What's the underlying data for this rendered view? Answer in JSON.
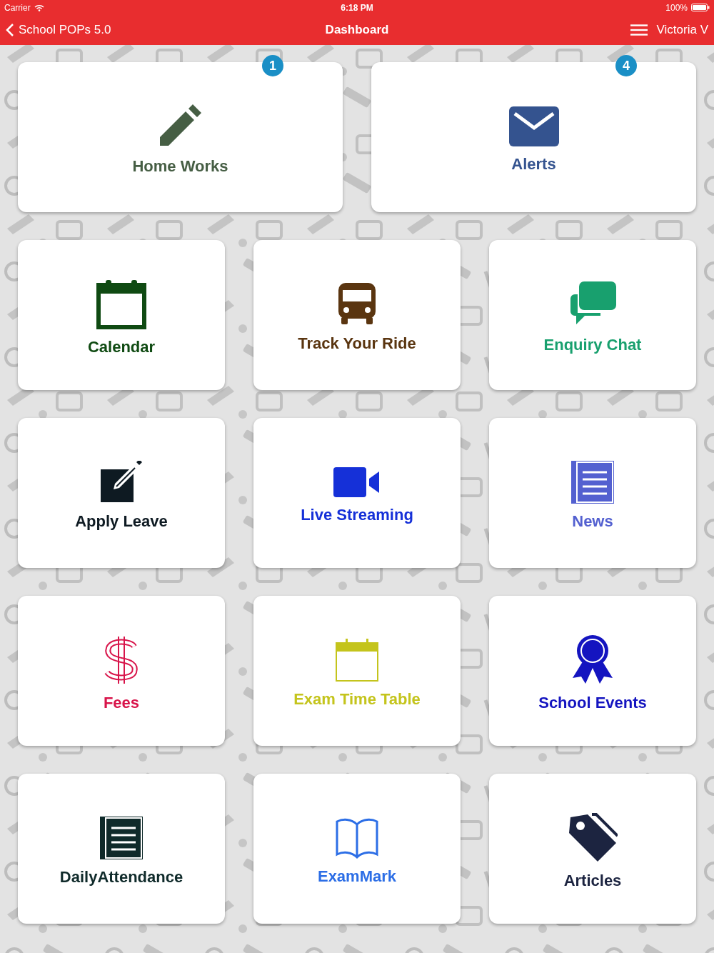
{
  "status_bar": {
    "carrier": "Carrier",
    "time": "6:18 PM",
    "battery": "100%"
  },
  "nav_bar": {
    "back_label": "School POPs 5.0",
    "title": "Dashboard",
    "user": "Victoria V"
  },
  "featured_tiles": [
    {
      "label": "Home Works",
      "kind": "pencil",
      "color": "#465e44",
      "badge": "1"
    },
    {
      "label": "Alerts",
      "kind": "envelope",
      "color": "#34538f",
      "badge": "4"
    }
  ],
  "tiles": [
    {
      "label": "Calendar",
      "kind": "calendar",
      "color": "#0f4a12"
    },
    {
      "label": "Track Your Ride",
      "kind": "bus",
      "color": "#5a3510"
    },
    {
      "label": "Enquiry Chat",
      "kind": "chat",
      "color": "#18a06e"
    },
    {
      "label": "Apply Leave",
      "kind": "edit",
      "color": "#0e1a22"
    },
    {
      "label": "Live Streaming",
      "kind": "video",
      "color": "#1530d8"
    },
    {
      "label": "News",
      "kind": "news",
      "color": "#5360d0"
    },
    {
      "label": "Fees",
      "kind": "dollar",
      "color": "#d8144a"
    },
    {
      "label": "Exam Time Table",
      "kind": "timetable",
      "color": "#c4c41c"
    },
    {
      "label": "School Events",
      "kind": "award",
      "color": "#1414c0"
    },
    {
      "label": "DailyAttendance",
      "kind": "list",
      "color": "#0f2a2a"
    },
    {
      "label": "ExamMark",
      "kind": "book",
      "color": "#2c6ee6"
    },
    {
      "label": "Articles",
      "kind": "tag",
      "color": "#1c2440"
    }
  ]
}
